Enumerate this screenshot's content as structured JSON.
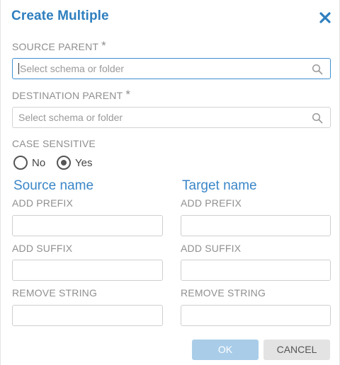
{
  "dialog": {
    "title": "Create Multiple",
    "close_icon": "close-icon"
  },
  "source_parent": {
    "label": "SOURCE PARENT",
    "required_mark": "*",
    "placeholder": "Select schema or folder",
    "icon": "search-icon"
  },
  "destination_parent": {
    "label": "DESTINATION PARENT",
    "required_mark": "*",
    "placeholder": "Select schema or folder",
    "icon": "search-icon"
  },
  "case_sensitive": {
    "label": "CASE SENSITIVE",
    "options": [
      "No",
      "Yes"
    ],
    "selected": "Yes"
  },
  "source": {
    "heading": "Source name",
    "add_prefix_label": "ADD PREFIX",
    "add_prefix_value": "",
    "add_suffix_label": "ADD SUFFIX",
    "add_suffix_value": "",
    "remove_string_label": "REMOVE STRING",
    "remove_string_value": ""
  },
  "target": {
    "heading": "Target name",
    "add_prefix_label": "ADD PREFIX",
    "add_prefix_value": "",
    "add_suffix_label": "ADD SUFFIX",
    "add_suffix_value": "",
    "remove_string_label": "REMOVE STRING",
    "remove_string_value": ""
  },
  "buttons": {
    "ok": "OK",
    "cancel": "CANCEL"
  },
  "colors": {
    "accent": "#2f7fbf",
    "ok_disabled": "#a9cde9",
    "cancel_bg": "#e3e3e3"
  }
}
